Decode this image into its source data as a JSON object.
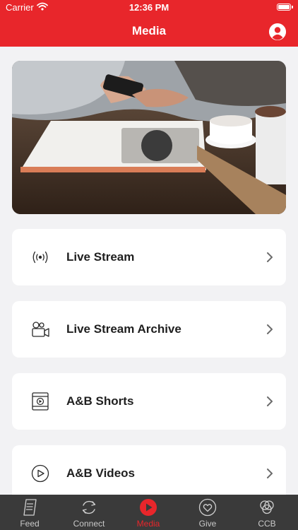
{
  "status_bar": {
    "carrier": "Carrier",
    "time": "12:36 PM"
  },
  "header": {
    "title": "Media",
    "profile_icon": "person-circle-icon"
  },
  "menu": [
    {
      "label": "Live Stream",
      "icon": "broadcast-icon"
    },
    {
      "label": "Live Stream Archive",
      "icon": "video-camera-icon"
    },
    {
      "label": "A&B Shorts",
      "icon": "film-play-icon"
    },
    {
      "label": "A&B Videos",
      "icon": "play-circle-icon"
    }
  ],
  "tabs": [
    {
      "label": "Feed",
      "icon": "document-icon"
    },
    {
      "label": "Connect",
      "icon": "sync-icon"
    },
    {
      "label": "Media",
      "icon": "play-button-icon",
      "active": true
    },
    {
      "label": "Give",
      "icon": "heart-circle-icon"
    },
    {
      "label": "CCB",
      "icon": "circles-icon"
    }
  ],
  "colors": {
    "brand": "#e8262b",
    "tab_bar": "#3a3a3a",
    "background": "#f2f2f4"
  }
}
